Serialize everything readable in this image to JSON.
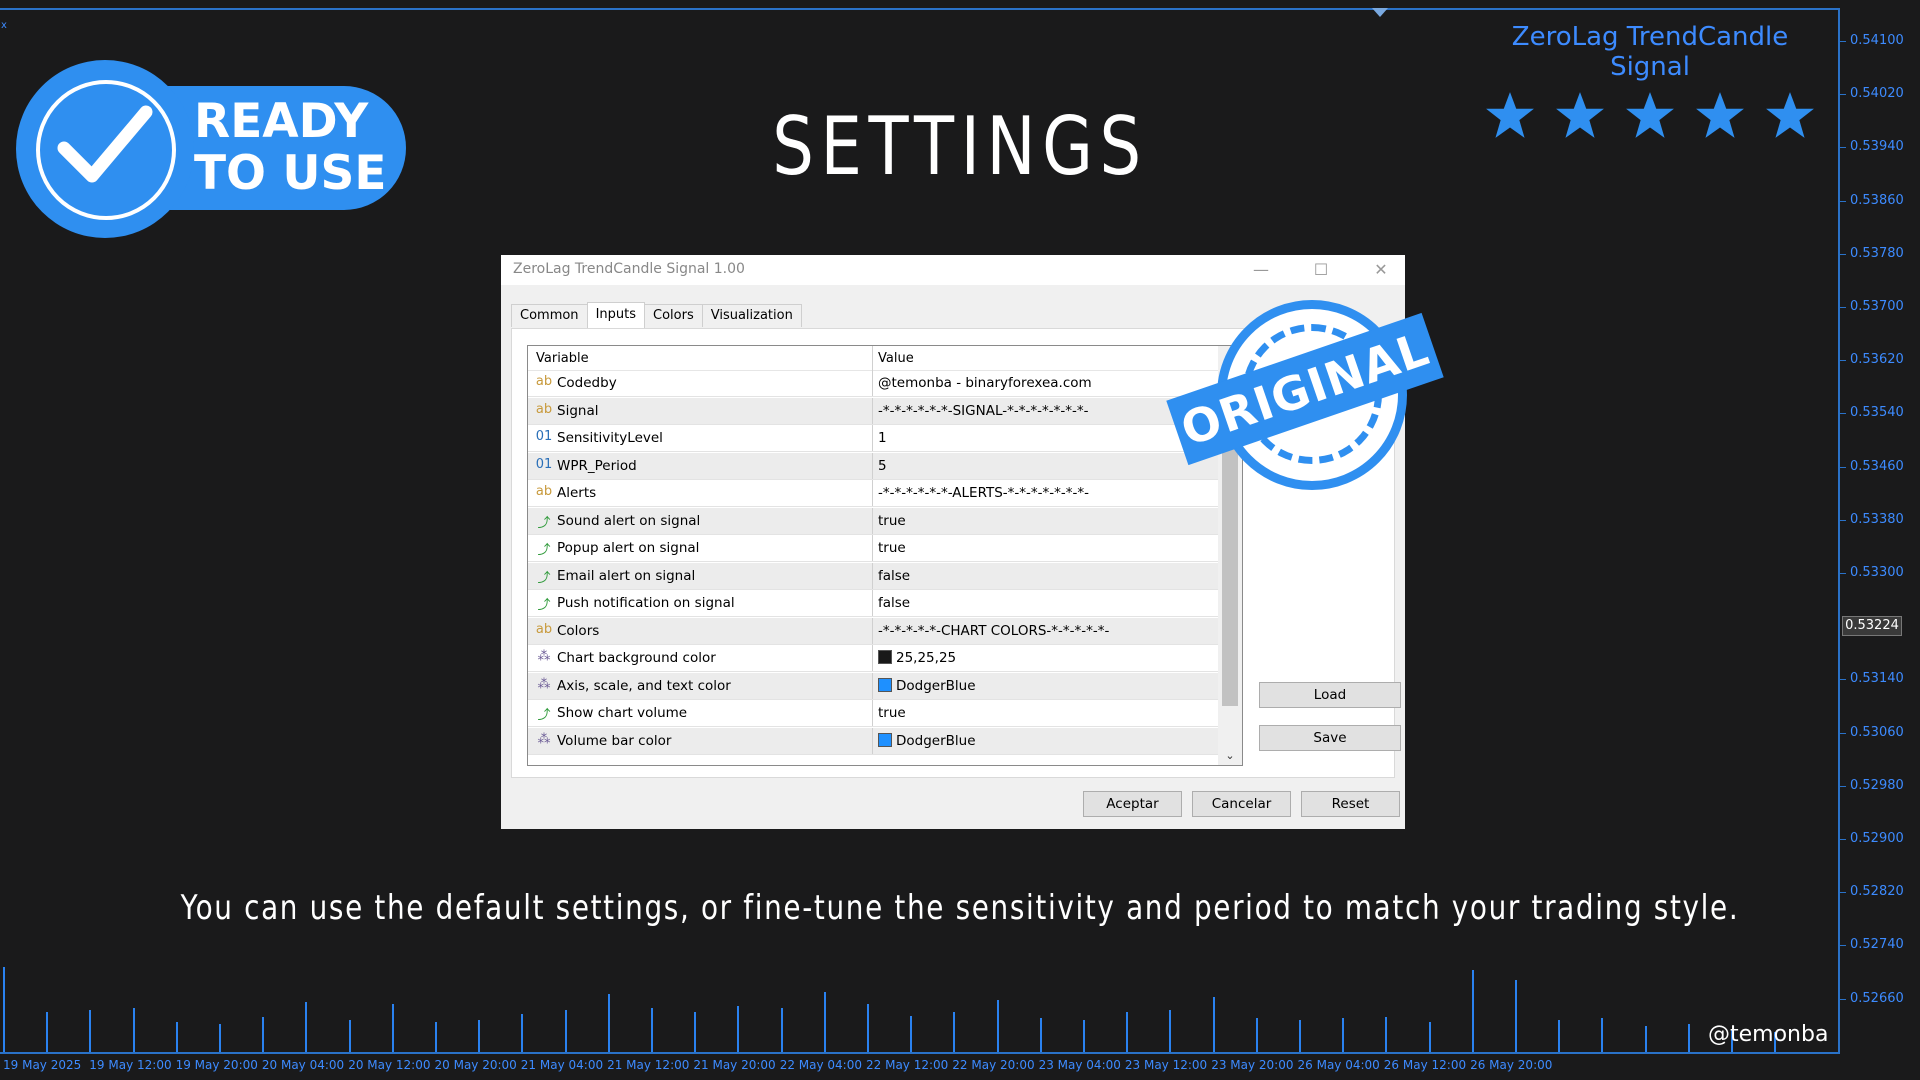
{
  "chart": {
    "corner_label": "x",
    "price_ticks": [
      "0.54100",
      "0.54020",
      "0.53940",
      "0.53860",
      "0.53780",
      "0.53700",
      "0.53620",
      "0.53540",
      "0.53460",
      "0.53380",
      "0.53300",
      "0.53140",
      "0.53060",
      "0.52980",
      "0.52900",
      "0.52820",
      "0.52740",
      "0.52660"
    ],
    "current_price": "0.53224",
    "time_ticks": [
      "19 May 2025",
      "19 May 12:00",
      "19 May 20:00",
      "20 May 04:00",
      "20 May 12:00",
      "20 May 20:00",
      "21 May 04:00",
      "21 May 12:00",
      "21 May 20:00",
      "22 May 04:00",
      "22 May 12:00",
      "22 May 20:00",
      "23 May 04:00",
      "23 May 12:00",
      "23 May 20:00",
      "26 May 04:00",
      "26 May 12:00",
      "26 May 20:00"
    ],
    "volume_values": [
      85,
      40,
      42,
      44,
      30,
      28,
      35,
      50,
      32,
      48,
      30,
      32,
      38,
      42,
      58,
      44,
      40,
      46,
      44,
      60,
      48,
      36,
      40,
      52,
      34,
      32,
      40,
      42,
      55,
      34,
      32,
      34,
      35,
      30,
      82,
      72,
      32,
      34,
      26,
      28,
      22,
      20
    ]
  },
  "badge": {
    "line1": "READY",
    "line2": "TO USE"
  },
  "page_title": "SETTINGS",
  "brand": {
    "name": "ZeroLag TrendCandle Signal",
    "rating_stars": 5
  },
  "dialog": {
    "title": "ZeroLag TrendCandle Signal 1.00",
    "tabs": [
      "Common",
      "Inputs",
      "Colors",
      "Visualization"
    ],
    "active_tab": "Inputs",
    "grid_headers": {
      "variable": "Variable",
      "value": "Value"
    },
    "rows": [
      {
        "icon": "ab",
        "variable": "Codedby",
        "value": "@temonba - binaryforexea.com"
      },
      {
        "icon": "ab",
        "variable": "Signal",
        "value": "-*-*-*-*-*-*-SIGNAL-*-*-*-*-*-*-*-"
      },
      {
        "icon": "01",
        "variable": "SensitivityLevel",
        "value": "1"
      },
      {
        "icon": "01",
        "variable": "WPR_Period",
        "value": "5"
      },
      {
        "icon": "ab",
        "variable": "Alerts",
        "value": "-*-*-*-*-*-*-ALERTS-*-*-*-*-*-*-*-"
      },
      {
        "icon": "bool",
        "variable": "Sound alert on signal",
        "value": "true"
      },
      {
        "icon": "bool",
        "variable": "Popup alert on signal",
        "value": "true"
      },
      {
        "icon": "bool",
        "variable": "Email alert on signal",
        "value": "false"
      },
      {
        "icon": "bool",
        "variable": "Push notification on signal",
        "value": "false"
      },
      {
        "icon": "ab",
        "variable": "Colors",
        "value": "-*-*-*-*-*-CHART COLORS-*-*-*-*-*-"
      },
      {
        "icon": "color",
        "variable": "Chart background color",
        "value": "25,25,25",
        "swatch": "#191919"
      },
      {
        "icon": "color",
        "variable": "Axis, scale, and text color",
        "value": "DodgerBlue",
        "swatch": "#1e90ff"
      },
      {
        "icon": "bool",
        "variable": "Show chart volume",
        "value": "true"
      },
      {
        "icon": "color",
        "variable": "Volume bar color",
        "value": "DodgerBlue",
        "swatch": "#1e90ff"
      }
    ],
    "buttons": {
      "load": "Load",
      "save": "Save",
      "accept": "Aceptar",
      "cancel": "Cancelar",
      "reset": "Reset"
    }
  },
  "stamp_text": "ORIGINAL",
  "caption": "You can use the default settings, or fine-tune the sensitivity and period to match your trading style.",
  "watermark": "@temonba",
  "colors": {
    "accent": "#2f8ff0",
    "axis_text": "#3d8bff",
    "background": "#1a1a1b"
  }
}
